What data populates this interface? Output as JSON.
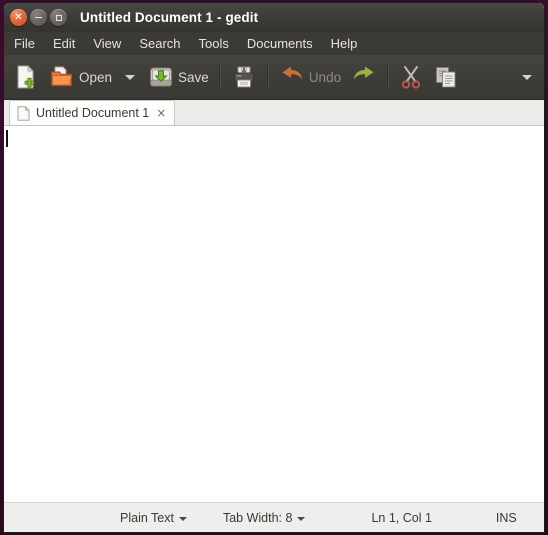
{
  "window": {
    "title": "Untitled Document 1 - gedit",
    "controls": {
      "close_label": "×",
      "minimize_label": "−",
      "maximize_label": "□"
    }
  },
  "menubar": {
    "items": [
      {
        "label": "File"
      },
      {
        "label": "Edit"
      },
      {
        "label": "View"
      },
      {
        "label": "Search"
      },
      {
        "label": "Tools"
      },
      {
        "label": "Documents"
      },
      {
        "label": "Help"
      }
    ]
  },
  "toolbar": {
    "new_icon": "new-document-icon",
    "open_icon": "open-folder-icon",
    "open_label": "Open",
    "open_dropdown_icon": "chevron-down-icon",
    "save_icon": "save-disk-icon",
    "save_label": "Save",
    "print_icon": "print-icon",
    "undo_icon": "undo-arrow-icon",
    "undo_label": "Undo",
    "redo_icon": "redo-arrow-icon",
    "cut_icon": "scissors-icon",
    "copy_icon": "copy-icon",
    "overflow_icon": "chevron-down-icon"
  },
  "tabs": [
    {
      "icon": "document-icon",
      "label": "Untitled Document 1",
      "close_label": "×",
      "active": true
    }
  ],
  "editor": {
    "content": "",
    "caret_visible": true
  },
  "statusbar": {
    "language": "Plain Text",
    "language_chevron": "chevron-down-icon",
    "tab_width": "Tab Width: 8",
    "tab_width_chevron": "chevron-down-icon",
    "cursor_position": "Ln 1, Col 1",
    "insert_mode": "INS"
  },
  "colors": {
    "titlebar": "#3c3a36",
    "toolbar": "#3f3d38",
    "desktop": "#2d0a24",
    "close_button": "#e2683a",
    "statusbar": "#f0eeec",
    "editor_background": "#ffffff",
    "tab_active": "#fdfdfd"
  }
}
